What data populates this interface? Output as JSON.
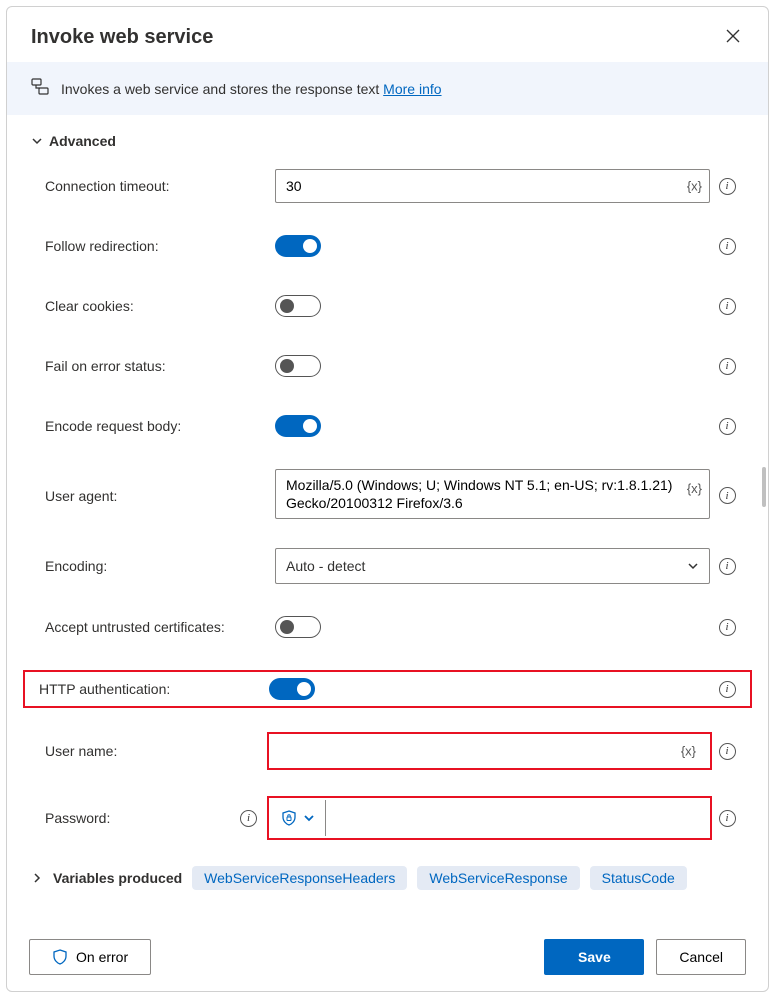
{
  "header": {
    "title": "Invoke web service"
  },
  "description": {
    "text": "Invokes a web service and stores the response text",
    "link": "More info"
  },
  "section": {
    "title": "Advanced"
  },
  "fields": {
    "connection_timeout": {
      "label": "Connection timeout:",
      "value": "30"
    },
    "follow_redirection": {
      "label": "Follow redirection:",
      "on": true
    },
    "clear_cookies": {
      "label": "Clear cookies:",
      "on": false
    },
    "fail_on_error": {
      "label": "Fail on error status:",
      "on": false
    },
    "encode_body": {
      "label": "Encode request body:",
      "on": true
    },
    "user_agent": {
      "label": "User agent:",
      "value": "Mozilla/5.0 (Windows; U; Windows NT 5.1; en-US; rv:1.8.1.21) Gecko/20100312 Firefox/3.6"
    },
    "encoding": {
      "label": "Encoding:",
      "value": "Auto - detect"
    },
    "accept_untrusted": {
      "label": "Accept untrusted certificates:",
      "on": false
    },
    "http_auth": {
      "label": "HTTP authentication:",
      "on": true
    },
    "username": {
      "label": "User name:",
      "value": ""
    },
    "password": {
      "label": "Password:",
      "value": ""
    }
  },
  "variables": {
    "label": "Variables produced",
    "chips": [
      "WebServiceResponseHeaders",
      "WebServiceResponse",
      "StatusCode"
    ]
  },
  "footer": {
    "on_error": "On error",
    "save": "Save",
    "cancel": "Cancel"
  },
  "icons": {
    "variable": "{x}"
  }
}
